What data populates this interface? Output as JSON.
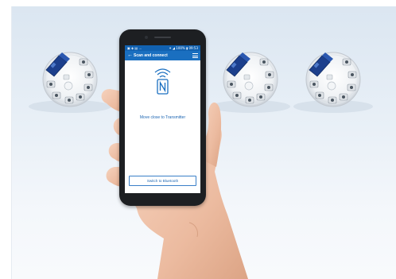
{
  "phone": {
    "status": {
      "left": "▣ ◈ ▤ ...",
      "right": "✶ ◢ 100% ▮ 09:53"
    },
    "appbar": {
      "back_icon": "back-arrow-icon",
      "title": "Scan and connect",
      "menu_icon": "hamburger-menu-icon"
    },
    "nfc": {
      "icon": "nfc-icon"
    },
    "instruction": "Move close to Transmitter",
    "bluetooth_button": "Switch to Bluetooth"
  },
  "colors": {
    "accent": "#1a6fc0",
    "background": "#dbe6f1",
    "transmitter_cap": "#1c3f8c"
  }
}
